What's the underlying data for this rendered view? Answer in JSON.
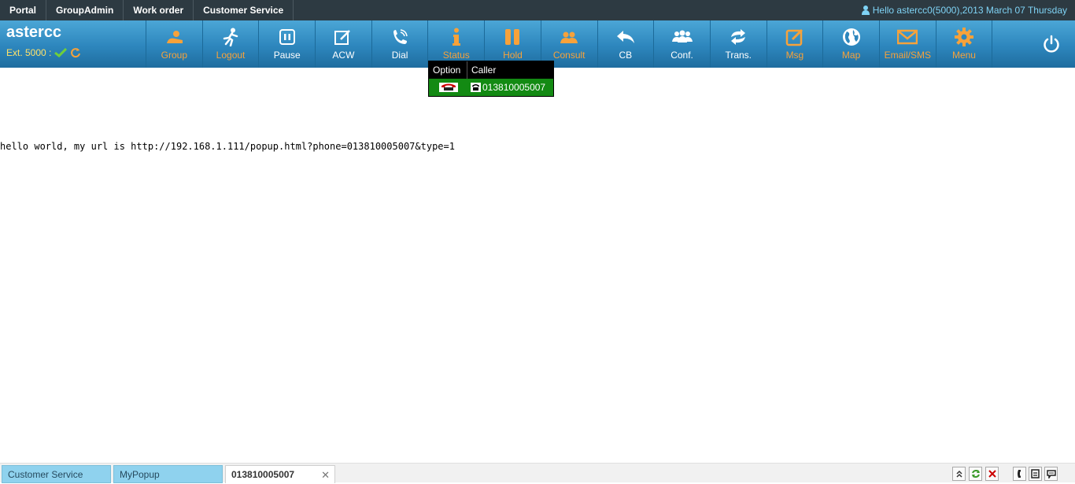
{
  "topnav": {
    "links": [
      "Portal",
      "GroupAdmin",
      "Work order",
      "Customer Service"
    ],
    "greeting": "Hello astercc0(5000),2013 March 07 Thursday"
  },
  "brand": {
    "name": "astercc",
    "ext": "Ext. 5000 :"
  },
  "toolbar": {
    "buttons": [
      {
        "label": "Group",
        "icon": "group-icon"
      },
      {
        "label": "Logout",
        "icon": "logout-icon"
      },
      {
        "label": "Pause",
        "icon": "pause-icon"
      },
      {
        "label": "ACW",
        "icon": "edit-icon"
      },
      {
        "label": "Dial",
        "icon": "phone-icon"
      },
      {
        "label": "Status",
        "icon": "info-icon"
      },
      {
        "label": "Hold",
        "icon": "hold-icon"
      },
      {
        "label": "Consult",
        "icon": "consult-icon"
      },
      {
        "label": "CB",
        "icon": "callback-icon"
      },
      {
        "label": "Conf.",
        "icon": "conference-icon"
      },
      {
        "label": "Trans.",
        "icon": "transfer-icon"
      },
      {
        "label": "Msg",
        "icon": "message-icon"
      },
      {
        "label": "Map",
        "icon": "globe-icon"
      },
      {
        "label": "Email/SMS",
        "icon": "envelope-icon"
      },
      {
        "label": "Menu",
        "icon": "gear-icon"
      }
    ]
  },
  "popup": {
    "headers": [
      "Option",
      "Caller"
    ],
    "caller": "013810005007"
  },
  "content": {
    "text": "hello world, my url is http://192.168.1.111/popup.html?phone=013810005007&type=1"
  },
  "tabs": [
    "Customer Service",
    "MyPopup",
    "013810005007"
  ],
  "colors": {
    "toolbar": "#2d86bd",
    "accent_orange": "#f7a23a",
    "popup_row": "#138a13"
  }
}
